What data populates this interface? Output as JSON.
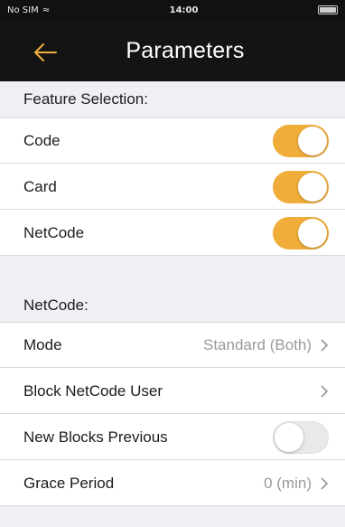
{
  "status_bar": {
    "carrier": "No SIM",
    "time": "14:00"
  },
  "nav": {
    "title": "Parameters",
    "back_icon": "arrow-left-icon",
    "accent_color": "#f0ad3a"
  },
  "feature_section": {
    "header": "Feature Selection:",
    "rows": [
      {
        "label": "Code",
        "toggle": "on"
      },
      {
        "label": "Card",
        "toggle": "on"
      },
      {
        "label": "NetCode",
        "toggle": "on"
      }
    ]
  },
  "netcode_section": {
    "header": "NetCode:",
    "mode": {
      "label": "Mode",
      "value": "Standard (Both)"
    },
    "block_user": {
      "label": "Block NetCode User"
    },
    "new_blocks_previous": {
      "label": "New Blocks Previous",
      "toggle": "off"
    },
    "grace_period": {
      "label": "Grace Period",
      "value": "0 (min)"
    }
  }
}
